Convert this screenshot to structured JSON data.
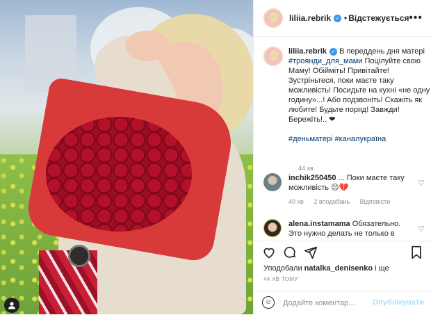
{
  "header": {
    "username": "liliia.rebrik",
    "follow_label": "Відстежується",
    "more_label": "•••"
  },
  "caption": {
    "username": "liliia.rebrik",
    "text_1": " В переддень дня матері ",
    "hashtag_1": "#троянди_для_мами",
    "text_2": " Поцілуйте свою Маму! Обійміть! Привітайте! Зустріньтеся, поки маєте таку можливість! Посидьте на кухні «не одну годину»...! Або подзвоніть! Скажіть як любите! Будьте поряд! Завжди! Бережіть!.. ❤",
    "hashtags_2": "#деньматері #каналукраїна",
    "time": "44 хв"
  },
  "comments": [
    {
      "username": "inchik250450",
      "text": " ... Поки маєте таку можливість 😔💔",
      "time": "40 хв",
      "likes": "2 вподобань",
      "reply": "Відповісти"
    },
    {
      "username": "alena.instamama",
      "text": " Обязательно. Это нужно делать не только в"
    }
  ],
  "likes": {
    "prefix": "Уподобали ",
    "user": "natalka_denisenko",
    "suffix": " і ще"
  },
  "post_time": "44 ХВ ТОМУ",
  "comment_box": {
    "placeholder": "Додайте коментар...",
    "post_label": "Опублікувати"
  },
  "icons": [
    "heart-icon",
    "comment-icon",
    "share-icon",
    "bookmark-icon",
    "emoji-icon",
    "more-icon",
    "verified-icon",
    "user-icon"
  ],
  "colors": {
    "link": "#00376b",
    "verified": "#3897f0",
    "muted": "#8e8e8e",
    "post_disabled": "#b2dffc"
  }
}
